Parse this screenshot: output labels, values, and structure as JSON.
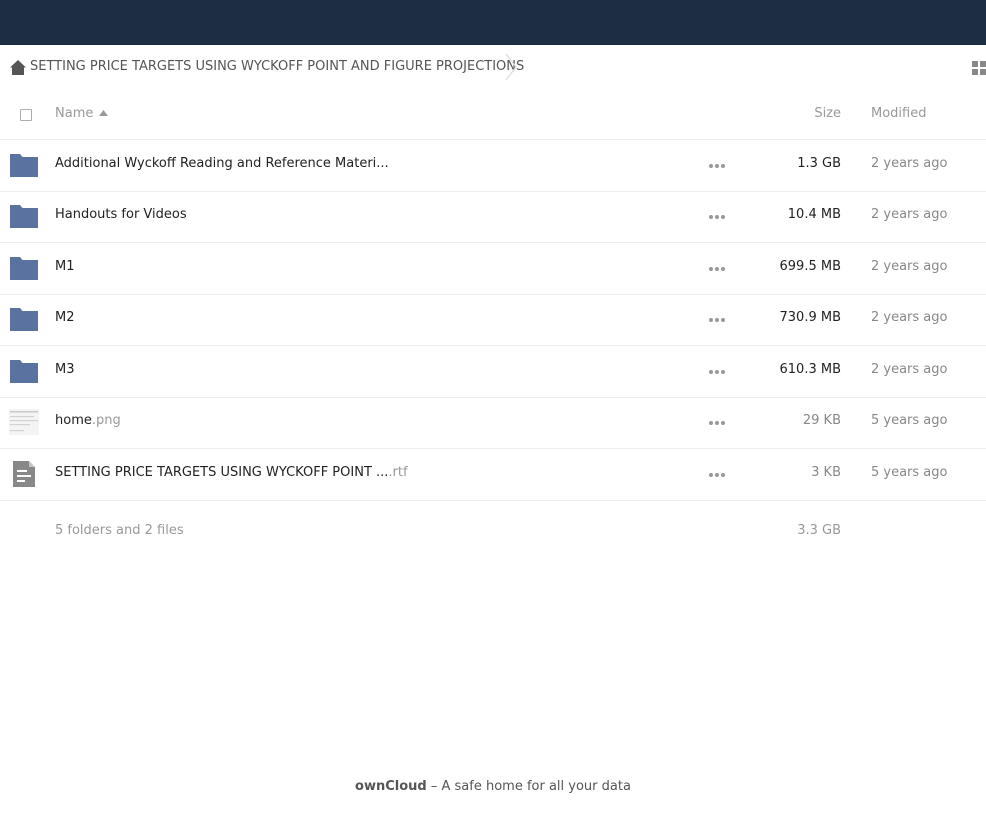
{
  "breadcrumb": {
    "title": "SETTING PRICE TARGETS USING WYCKOFF POINT AND FIGURE PROJECTIONS"
  },
  "header": {
    "name": "Name",
    "size": "Size",
    "modified": "Modified"
  },
  "files": [
    {
      "type": "folder",
      "name": "Additional Wyckoff Reading and Reference Materi...",
      "ext": "",
      "size": "1.3 GB",
      "modified": "2 years ago"
    },
    {
      "type": "folder",
      "name": "Handouts for Videos",
      "ext": "",
      "size": "10.4 MB",
      "modified": "2 years ago"
    },
    {
      "type": "folder",
      "name": "M1",
      "ext": "",
      "size": "699.5 MB",
      "modified": "2 years ago"
    },
    {
      "type": "folder",
      "name": "M2",
      "ext": "",
      "size": "730.9 MB",
      "modified": "2 years ago"
    },
    {
      "type": "folder",
      "name": "M3",
      "ext": "",
      "size": "610.3 MB",
      "modified": "2 years ago"
    },
    {
      "type": "image",
      "name": "home",
      "ext": ".png",
      "size": "29 KB",
      "modified": "5 years ago"
    },
    {
      "type": "document",
      "name": "SETTING PRICE TARGETS USING WYCKOFF POINT ...",
      "ext": ".rtf",
      "size": "3 KB",
      "modified": "5 years ago"
    }
  ],
  "summary": {
    "files": "5 folders and 2 files",
    "size": "3.3 GB"
  },
  "footer": {
    "brand": "ownCloud",
    "tagline": " – A safe home for all your data"
  },
  "colors": {
    "topbar": "#1d2d44",
    "folder": "#5a72a0",
    "document": "#888888"
  }
}
